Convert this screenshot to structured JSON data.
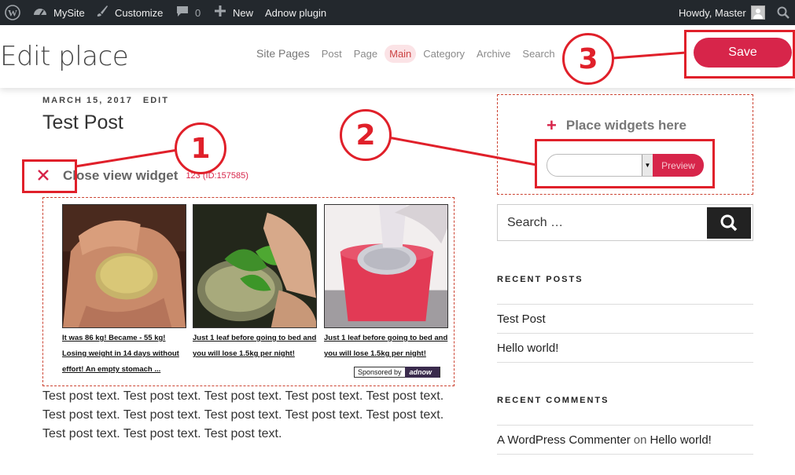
{
  "adminbar": {
    "site_name": "MySite",
    "customize": "Customize",
    "comments_count": "0",
    "new_label": "New",
    "plugin_label": "Adnow plugin",
    "howdy": "Howdy, Master",
    "icons": [
      "wordpress-logo-icon",
      "dashboard-icon",
      "brush-icon",
      "comment-icon",
      "plus-icon",
      "avatar",
      "search-icon"
    ]
  },
  "header": {
    "title": "Edit place",
    "tabs": [
      "Site Pages",
      "Post",
      "Page",
      "Main",
      "Category",
      "Archive",
      "Search"
    ],
    "active_tab": "Main",
    "save_label": "Save"
  },
  "post": {
    "date": "MARCH 15, 2017",
    "edit": "EDIT",
    "title": "Test Post",
    "close_widget_label": "Close view widget",
    "widget_id": "123 (ID:157585)",
    "body": "Test post text. Test post text. Test post text. Test post text. Test post text. Test post text. Test post text. Test post text. Test post text. Test post text. Test post text. Test post text. Test post text."
  },
  "ads": [
    {
      "text": "It was 86 kg! Became - 55 kg! Losing weight in 14 days without effort! An empty stomach ...",
      "image": "lemon-hand"
    },
    {
      "text": "Just 1 leaf before going to bed and you will lose 1.5kg per night!",
      "image": "herb-leaf"
    },
    {
      "text": "Just 1 leaf before going to bed and you will lose 1.5kg per night!",
      "image": "red-drink"
    }
  ],
  "sponsored": {
    "label": "Sponsored by",
    "brand": "adnow"
  },
  "sidebar": {
    "place_widgets": "Place widgets here",
    "select_value": "",
    "preview_label": "Preview",
    "search_placeholder": "Search …",
    "recent_posts_title": "RECENT POSTS",
    "recent_posts": [
      "Test Post",
      "Hello world!"
    ],
    "recent_comments_title": "RECENT COMMENTS",
    "comment": {
      "author": "A WordPress Commenter",
      "on": "on",
      "post": "Hello world!"
    }
  },
  "callouts": [
    "1",
    "2",
    "3"
  ],
  "colors": {
    "accent": "#d7254a",
    "callout": "#e0202a",
    "adminbar": "#23282d"
  }
}
